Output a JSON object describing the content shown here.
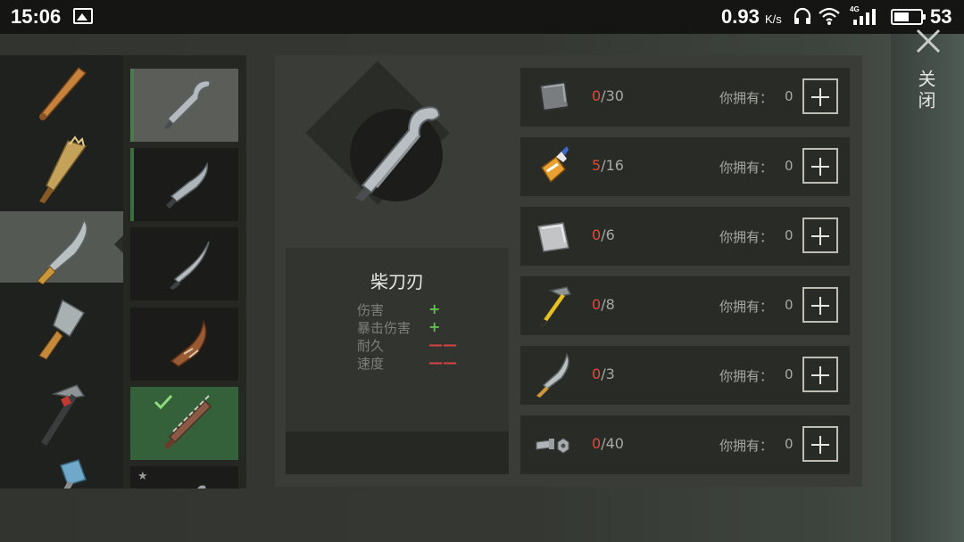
{
  "status_bar": {
    "time": "15:06",
    "net_speed": "0.93",
    "net_unit": "K/s",
    "network_type": "4G",
    "battery_level": "53"
  },
  "close": {
    "label": "关闭"
  },
  "categories": [
    {
      "icon": "baseball-bat-icon"
    },
    {
      "icon": "plank-club-icon"
    },
    {
      "icon": "machete-icon",
      "selected": true
    },
    {
      "icon": "cleaver-icon"
    },
    {
      "icon": "hammer-icon"
    },
    {
      "icon": "sledgehammer-icon"
    }
  ],
  "variants": [
    {
      "icon": "hook-blade-icon",
      "state": "active"
    },
    {
      "icon": "kukri-blade-icon",
      "state": "owned"
    },
    {
      "icon": "curved-blade-icon",
      "state": "locked"
    },
    {
      "icon": "wrapped-blade-icon",
      "state": "locked"
    },
    {
      "icon": "saw-blade-icon",
      "state": "done"
    },
    {
      "icon": "starred-blade-icon",
      "state": "locked"
    }
  ],
  "detail": {
    "name": "柴刀刃",
    "stats": [
      {
        "label": "伤害",
        "value": "+",
        "type": "plus"
      },
      {
        "label": "暴击伤害",
        "value": "+",
        "type": "plus"
      },
      {
        "label": "耐久",
        "value": "——",
        "type": "minus"
      },
      {
        "label": "速度",
        "value": "——",
        "type": "minus"
      }
    ]
  },
  "requirements": [
    {
      "icon": "metal-plate-icon",
      "have": "0",
      "need": "/30",
      "own_label": "你拥有：",
      "own": "0"
    },
    {
      "icon": "glue-bottle-icon",
      "have": "5",
      "need": "/16",
      "own_label": "你拥有：",
      "own": "0"
    },
    {
      "icon": "steel-sheet-icon",
      "have": "0",
      "need": "/6",
      "own_label": "你拥有：",
      "own": "0"
    },
    {
      "icon": "hammer-icon",
      "have": "0",
      "need": "/8",
      "own_label": "你拥有：",
      "own": "0"
    },
    {
      "icon": "machete-icon",
      "have": "0",
      "need": "/3",
      "own_label": "你拥有：",
      "own": "0"
    },
    {
      "icon": "nuts-bolts-icon",
      "have": "0",
      "need": "/40",
      "own_label": "你拥有：",
      "own": "0"
    }
  ]
}
